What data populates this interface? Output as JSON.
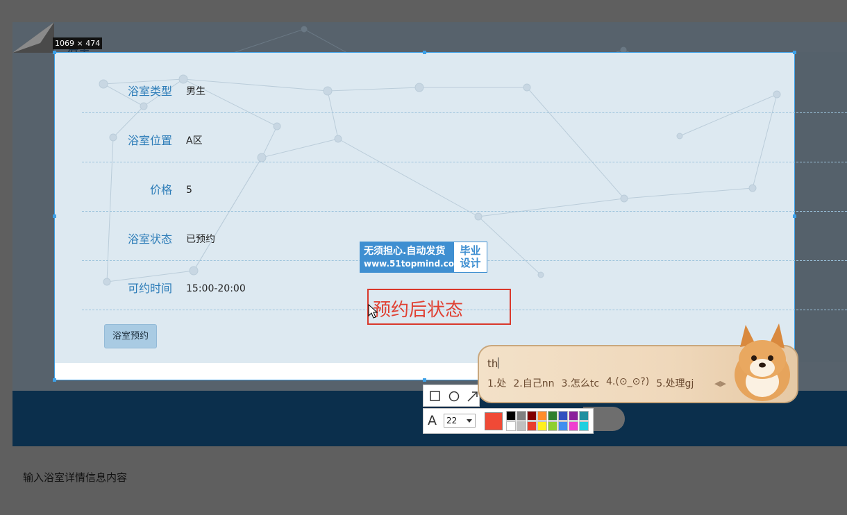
{
  "background_page": {
    "title": "浴室",
    "bottom_text": "输入浴室详情信息内容"
  },
  "capture": {
    "size_label": "1069 × 474"
  },
  "form": {
    "rows": [
      {
        "label": "浴室类型",
        "value": "男生"
      },
      {
        "label": "浴室位置",
        "value": "A区"
      },
      {
        "label": "价格",
        "value": "5"
      },
      {
        "label": "浴室状态",
        "value": "已预约"
      },
      {
        "label": "可约时间",
        "value": "15:00-20:00"
      }
    ],
    "book_button": "浴室预约"
  },
  "watermark": {
    "line1": "无须担心.自动发货",
    "line2": "www.51topmind.com",
    "right": "毕业设计"
  },
  "annotation": {
    "text": "预约后状态",
    "color": "#e04133"
  },
  "toolbar": {
    "tools": [
      "rectangle-icon",
      "ellipse-icon",
      "arrow-icon"
    ],
    "font_size": "22",
    "current_color": "#f04a36",
    "palette": [
      "#000000",
      "#808080",
      "#800000",
      "#ff8c2a",
      "#2f7f2f",
      "#2f4fbf",
      "#8b1f9b",
      "#1f8f9f",
      "#ffffff",
      "#c0c0c0",
      "#e8402f",
      "#ffef1f",
      "#8fcf2f",
      "#3f8fef",
      "#ef3fcf",
      "#1fcfdf"
    ]
  },
  "ime": {
    "composition": "th",
    "candidates": [
      "1.处",
      "2.自己nn",
      "3.怎么tc",
      "4.(⊙_⊙?)",
      "5.处理gj"
    ],
    "arrows": "◀▶"
  }
}
